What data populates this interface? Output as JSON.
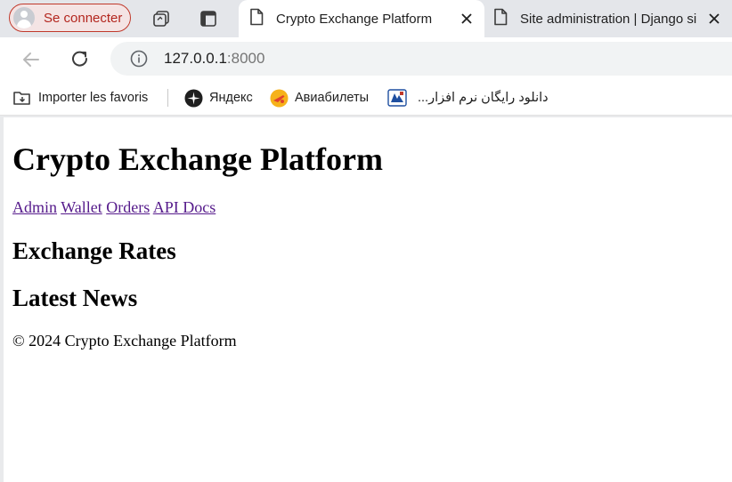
{
  "browser": {
    "profile_label": "Se connecter",
    "tabs": [
      {
        "title": "Crypto Exchange Platform",
        "active": true
      },
      {
        "title": "Site administration | Django si",
        "active": false
      }
    ],
    "url_host": "127.0.0.1",
    "url_port": ":8000",
    "accent_color": "#c0392b",
    "link_visited_color": "#551a8b"
  },
  "bookmarks": [
    {
      "label": "Importer les favoris",
      "icon": "import-bookmarks-icon"
    },
    {
      "label": "Яндекс",
      "icon": "yandex-icon"
    },
    {
      "label": "Авиабилеты",
      "icon": "avia-icon"
    },
    {
      "label": "دانلود رایگان نرم افزار...",
      "icon": "soft98-icon"
    }
  ],
  "page": {
    "title": "Crypto Exchange Platform",
    "nav": [
      "Admin",
      "Wallet",
      "Orders",
      "API Docs"
    ],
    "rates_heading": "Exchange Rates",
    "news_heading": "Latest News",
    "footer": "© 2024 Crypto Exchange Platform"
  }
}
